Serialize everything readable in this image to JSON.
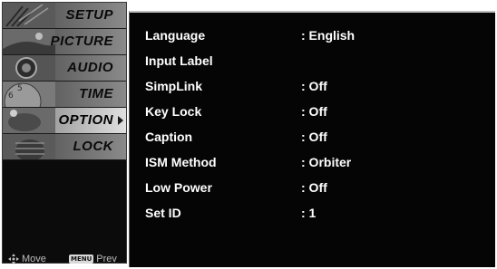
{
  "sidebar": {
    "items": [
      {
        "label": "SETUP",
        "icon": "antenna-icon"
      },
      {
        "label": "PICTURE",
        "icon": "picture-icon"
      },
      {
        "label": "AUDIO",
        "icon": "speaker-icon"
      },
      {
        "label": "TIME",
        "icon": "clock-icon"
      },
      {
        "label": "OPTION",
        "icon": "option-icon",
        "active": true
      },
      {
        "label": "LOCK",
        "icon": "padlock-icon"
      }
    ],
    "footer": {
      "move_label": "Move",
      "menu_key_label": "MENU",
      "prev_label": "Prev"
    }
  },
  "option_menu": {
    "rows": [
      {
        "name": "Language",
        "value": ": English"
      },
      {
        "name": "Input Label",
        "value": ""
      },
      {
        "name": "SimpLink",
        "value": ": Off"
      },
      {
        "name": "Key Lock",
        "value": ": Off"
      },
      {
        "name": "Caption",
        "value": ": Off"
      },
      {
        "name": "ISM Method",
        "value": ": Orbiter"
      },
      {
        "name": "Low Power",
        "value": ": Off"
      },
      {
        "name": "Set ID",
        "value": ": 1"
      }
    ]
  },
  "colors": {
    "background": "#050505",
    "text": "#ffffff",
    "sidebar_active": "#e0e0e0"
  }
}
